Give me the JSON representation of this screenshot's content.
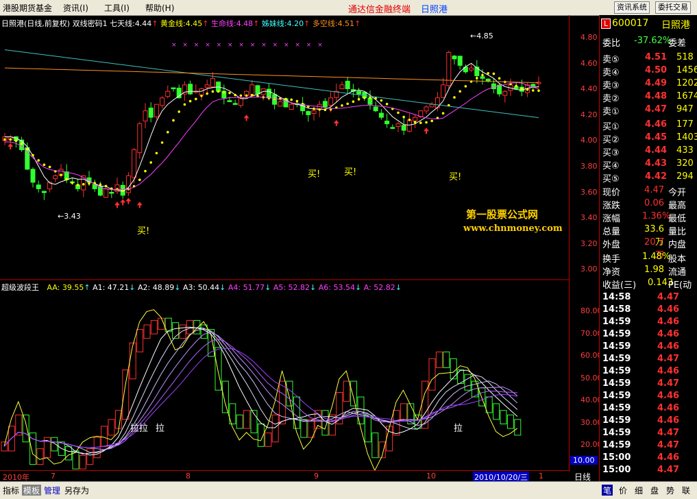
{
  "menu": {
    "items": [
      "港股期货基金",
      "资讯(I)",
      "工具(I)",
      "帮助(H)"
    ],
    "center_title": "通达信金融终端",
    "stock_name": "日照港",
    "btn_info": "资讯系统",
    "btn_trade": "委托交易"
  },
  "main_header": {
    "title": "日照港(日线,前复权)",
    "indicator": "双线密码1",
    "ma7_label": "七天线:",
    "ma7": "4.44",
    "gold_label": "黄金线:",
    "gold": "4.45",
    "life_label": "生命线:",
    "life": "4.48",
    "sister_label": "姊妹线:",
    "sister": "4.20",
    "ls_label": "多空线:",
    "ls": "4.51"
  },
  "main_axis": [
    "4.80",
    "4.60",
    "4.40",
    "4.20",
    "4.00",
    "3.80",
    "3.60",
    "3.40",
    "3.20",
    "3.00"
  ],
  "main_annotations": {
    "high": "4.85",
    "low": "3.43",
    "buy": "买!",
    "watermark1": "第一股票公式网",
    "watermark2": "www.chnmoney.com"
  },
  "sub_header": {
    "title": "超级波段王",
    "aa": "AA: 39.55",
    "a1": "A1: 47.21",
    "a2": "A2: 48.89",
    "a3": "A3: 50.44",
    "a4": "A4: 51.77",
    "a5": "A5: 52.82",
    "a6": "A6: 53.54",
    "a": "A: 52.82"
  },
  "sub_axis": [
    "80.00",
    "70.00",
    "60.00",
    "50.00",
    "40.00",
    "30.00",
    "20.00"
  ],
  "sub_annotations": {
    "la": "拉",
    "scale": "10.00",
    "period": "日线"
  },
  "date_axis": {
    "year": "2010年",
    "m7": "7",
    "m8": "8",
    "m9": "9",
    "m10": "10",
    "cursor": "2010/10/20/三",
    "m1": "1"
  },
  "quote": {
    "code": "600017",
    "name": "日照港",
    "wb_label": "委比",
    "wb": "-37.62%",
    "wc_label": "委差",
    "sells": [
      {
        "label": "卖⑤",
        "price": "4.51",
        "vol": "518"
      },
      {
        "label": "卖④",
        "price": "4.50",
        "vol": "1456"
      },
      {
        "label": "卖③",
        "price": "4.49",
        "vol": "1202"
      },
      {
        "label": "卖②",
        "price": "4.48",
        "vol": "1674"
      },
      {
        "label": "卖①",
        "price": "4.47",
        "vol": "947"
      }
    ],
    "buys": [
      {
        "label": "买①",
        "price": "4.46",
        "vol": "177"
      },
      {
        "label": "买②",
        "price": "4.45",
        "vol": "1403"
      },
      {
        "label": "买③",
        "price": "4.44",
        "vol": "433"
      },
      {
        "label": "买④",
        "price": "4.43",
        "vol": "320"
      },
      {
        "label": "买⑤",
        "price": "4.42",
        "vol": "294"
      }
    ],
    "stats": [
      {
        "l": "现价",
        "v": "4.47",
        "r": "今开"
      },
      {
        "l": "涨跌",
        "v": "0.06",
        "r": "最高"
      },
      {
        "l": "涨幅",
        "v": "1.36%",
        "r": "最低"
      },
      {
        "l": "总量",
        "v": "33.6万",
        "r": "量比"
      },
      {
        "l": "外盘",
        "v": "20.7万",
        "r": "内盘"
      }
    ],
    "stats2": [
      {
        "l": "换手",
        "v": "1.48%",
        "r": "股本"
      },
      {
        "l": "净资",
        "v": "1.98",
        "r": "流通"
      },
      {
        "l": "收益(三)",
        "v": "0.143",
        "r": "PE(动"
      }
    ]
  },
  "ticks": [
    {
      "t": "14:58",
      "p": "4.47",
      "c": "#ff3030"
    },
    {
      "t": "14:58",
      "p": "4.46",
      "c": "#ff3030"
    },
    {
      "t": "14:59",
      "p": "4.46",
      "c": "#ff3030"
    },
    {
      "t": "14:59",
      "p": "4.46",
      "c": "#ff3030"
    },
    {
      "t": "14:59",
      "p": "4.46",
      "c": "#ff3030"
    },
    {
      "t": "14:59",
      "p": "4.47",
      "c": "#ff3030"
    },
    {
      "t": "14:59",
      "p": "4.46",
      "c": "#ff3030"
    },
    {
      "t": "14:59",
      "p": "4.47",
      "c": "#ff3030"
    },
    {
      "t": "14:59",
      "p": "4.46",
      "c": "#ff3030"
    },
    {
      "t": "14:59",
      "p": "4.46",
      "c": "#ff3030"
    },
    {
      "t": "14:59",
      "p": "4.46",
      "c": "#ff3030"
    },
    {
      "t": "14:59",
      "p": "4.47",
      "c": "#ff3030"
    },
    {
      "t": "14:59",
      "p": "4.47",
      "c": "#ff3030"
    },
    {
      "t": "15:00",
      "p": "4.46",
      "c": "#ff3030"
    },
    {
      "t": "15:00",
      "p": "4.47",
      "c": "#ff3030"
    }
  ],
  "bottom": {
    "tabs": [
      "指标",
      "模板",
      "管理",
      "另存为"
    ],
    "right": [
      "笔",
      "价",
      "细",
      "盘",
      "势",
      "联"
    ]
  }
}
